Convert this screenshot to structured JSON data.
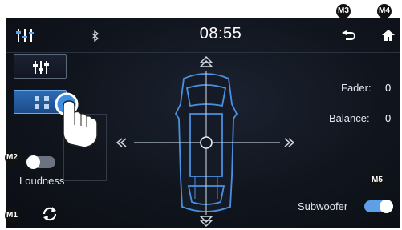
{
  "header": {
    "time": "08:55"
  },
  "icons": {
    "equalizer": "equalizer-icon",
    "bluetooth": "bluetooth-icon",
    "back": "back-icon",
    "home": "home-icon",
    "reset": "reset-icon"
  },
  "markers": {
    "m1": "M1",
    "m2": "M2",
    "m3": "M3",
    "m4": "M4",
    "m5": "M5"
  },
  "controls": {
    "loudness_label": "Loudness",
    "loudness_on": false,
    "subwoofer_label": "Subwoofer",
    "subwoofer_on": true
  },
  "balance_panel": {
    "fader_label": "Fader:",
    "fader_value": "0",
    "balance_label": "Balance:",
    "balance_value": "0"
  },
  "colors": {
    "accent": "#4a90e2",
    "background": "#10141c",
    "toggle_on": "#5ea0e8",
    "toggle_off": "#6b7380"
  }
}
